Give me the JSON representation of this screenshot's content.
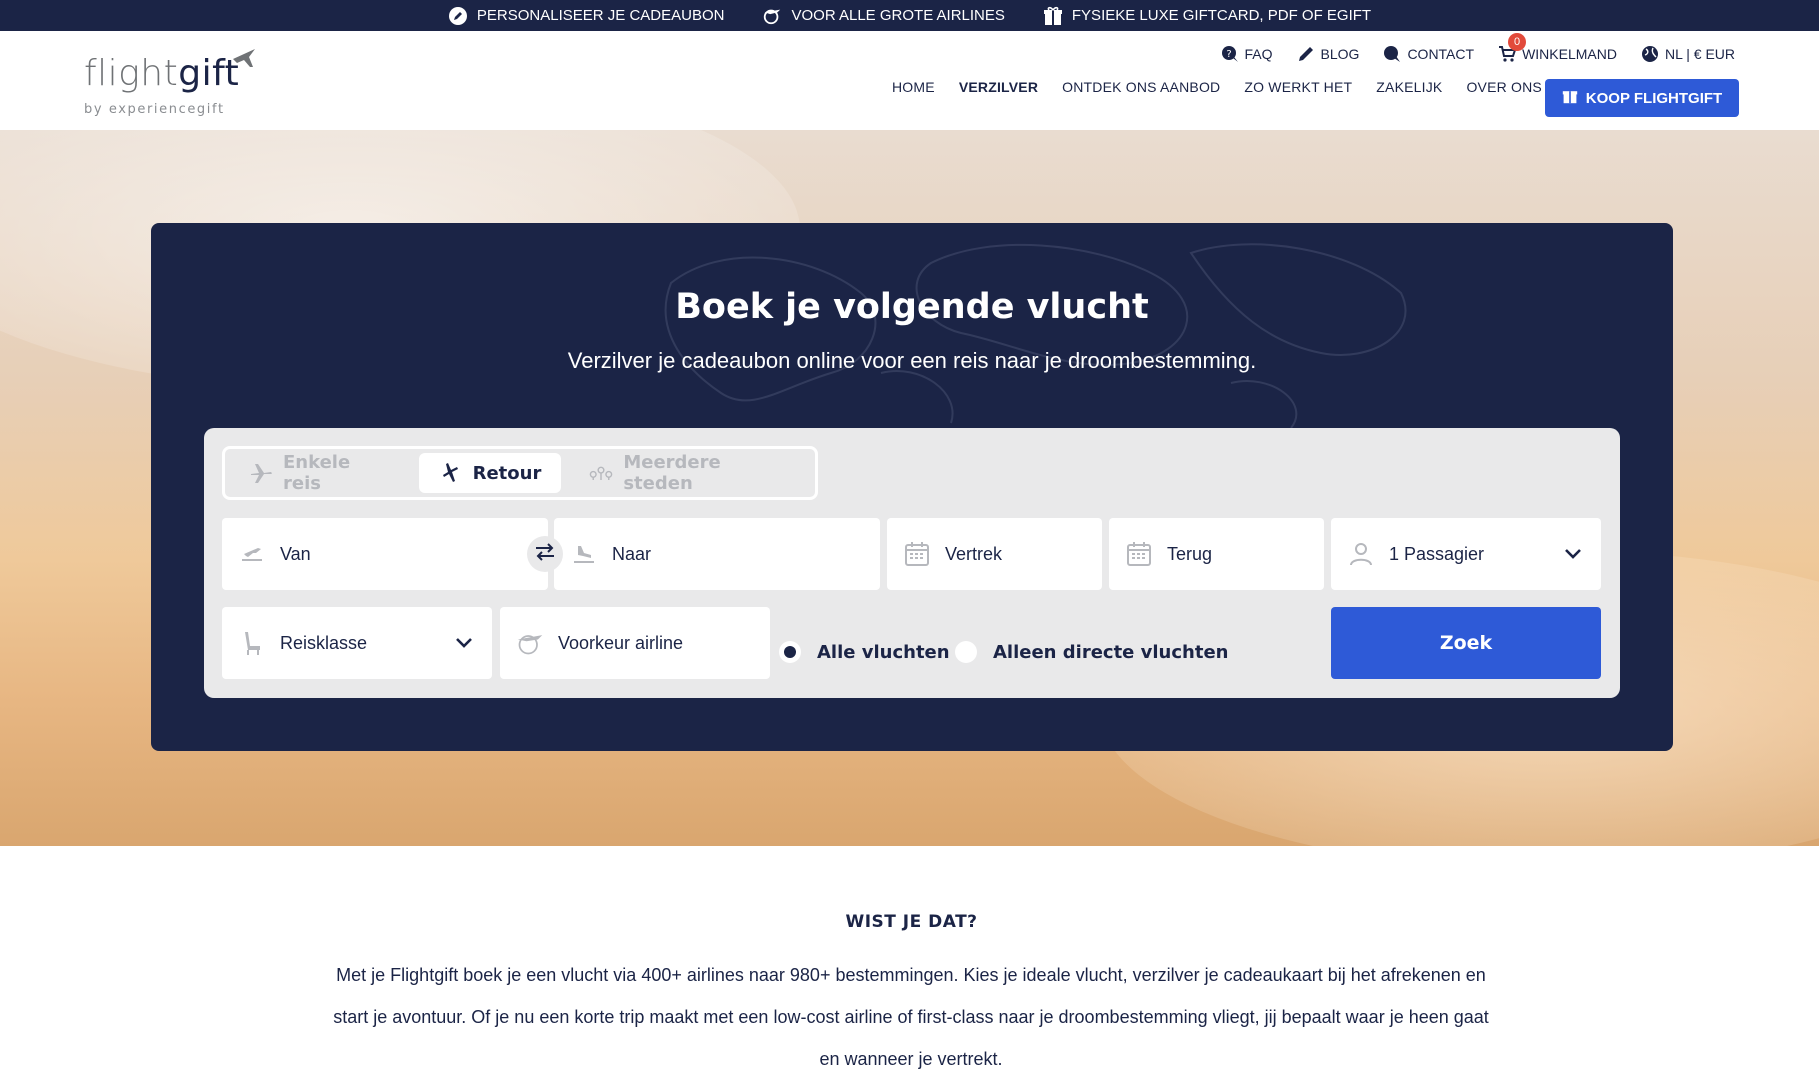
{
  "promo": {
    "items": [
      {
        "label": "PERSONALISEER JE CADEAUBON",
        "icon": "pen-icon"
      },
      {
        "label": "VOOR ALLE GROTE AIRLINES",
        "icon": "globe-plane-icon"
      },
      {
        "label": "FYSIEKE LUXE GIFTCARD, PDF OF EGIFT",
        "icon": "gift-icon"
      }
    ]
  },
  "header": {
    "logo_word_light": "flight",
    "logo_word_bold": "gift",
    "logo_sub": "by experiencegift",
    "util": {
      "faq": "FAQ",
      "blog": "BLOG",
      "contact": "CONTACT",
      "cart": "WINKELMAND",
      "cart_count": "0",
      "locale": "NL | € EUR"
    },
    "nav": {
      "home": "HOME",
      "redeem": "VERZILVER",
      "discover": "ONTDEK ONS AANBOD",
      "how": "ZO WERKT HET",
      "business": "ZAKELIJK",
      "about": "OVER ONS"
    },
    "buy_button": "KOOP FLIGHTGIFT"
  },
  "hero": {
    "title": "Boek je volgende vlucht",
    "subtitle": "Verzilver je cadeaubon online voor een reis naar je droombestemming.",
    "trip_tabs": {
      "oneway": "Enkele reis",
      "return": "Retour",
      "multi": "Meerdere steden",
      "selected": "Retour"
    },
    "fields": {
      "from": "Van",
      "to": "Naar",
      "depart": "Vertrek",
      "return": "Terug",
      "passengers": "1 Passagier",
      "class": "Reisklasse",
      "airline": "Voorkeur airline"
    },
    "radios": {
      "all": "Alle vluchten",
      "direct": "Alleen directe vluchten",
      "selected": "all"
    },
    "search_button": "Zoek"
  },
  "info": {
    "title": "WIST JE DAT?",
    "text": "Met je Flightgift boek je een vlucht via 400+ airlines naar 980+ bestemmingen. Kies je ideale vlucht, verzilver je cadeaukaart bij het afrekenen en start je avontuur. Of je nu een korte trip maakt met een low-cost airline of first-class naar je droombestemming vliegt, jij bepaalt waar je heen gaat en wanneer je vertrekt."
  },
  "colors": {
    "navy": "#1b2446",
    "accent_blue": "#2e5ad7",
    "badge_red": "#e24a3b"
  }
}
